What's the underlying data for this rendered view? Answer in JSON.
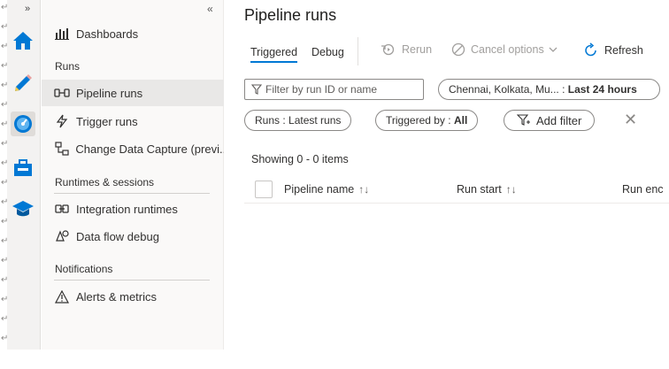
{
  "rail": {
    "expand_glyph": "»",
    "icons": [
      "home-icon",
      "author-pencil-icon",
      "monitor-gauge-icon",
      "manage-toolbox-icon",
      "learning-hat-icon"
    ]
  },
  "nav": {
    "collapse_glyph": "«",
    "items": {
      "dashboards": "Dashboards",
      "runs_header": "Runs",
      "pipeline_runs": "Pipeline runs",
      "trigger_runs": "Trigger runs",
      "cdc": "Change Data Capture (previ...",
      "runtimes_header": "Runtimes & sessions",
      "integration_runtimes": "Integration runtimes",
      "dataflow_debug": "Data flow debug",
      "notifications_header": "Notifications",
      "alerts": "Alerts & metrics"
    }
  },
  "main": {
    "title": "Pipeline runs",
    "tabs": [
      "Triggered",
      "Debug"
    ],
    "toolbar": {
      "rerun": "Rerun",
      "cancel": "Cancel options",
      "refresh": "Refresh"
    },
    "filter_placeholder": "Filter by run ID or name",
    "location_pill": {
      "prefix": "Chennai, Kolkata, Mu... :",
      "value": "Last 24 hours"
    },
    "runs_pill": {
      "prefix": "Runs :",
      "value": "Latest runs"
    },
    "triggered_pill": {
      "prefix": "Triggered by :",
      "value": "All"
    },
    "add_filter": "Add filter",
    "count_text": "Showing 0 - 0 items",
    "columns": [
      "Pipeline name",
      "Run start",
      "Run enc"
    ]
  },
  "colors": {
    "accent": "#0078d4",
    "rail_bg": "#f3f2f1",
    "nav_active": "#e9e8e7"
  }
}
